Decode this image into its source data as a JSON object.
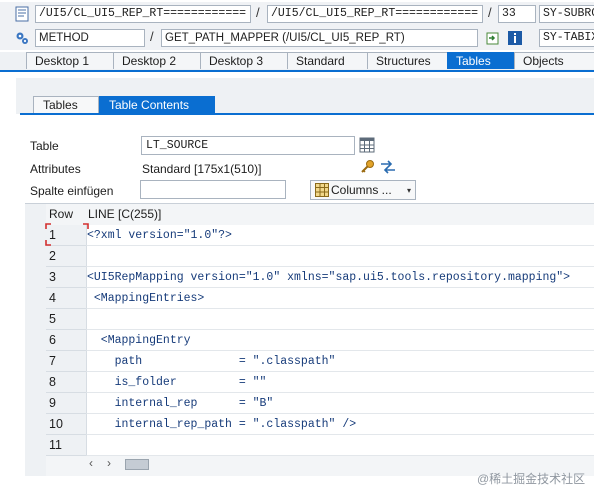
{
  "header": {
    "row1": {
      "program": "/UI5/CL_UI5_REP_RT============",
      "include": "/UI5/CL_UI5_REP_RT============",
      "line": "33",
      "sysvar": "SY-SUBRC"
    },
    "row2": {
      "event_type": "METHOD",
      "event": "GET_PATH_MAPPER (/UI5/CL_UI5_REP_RT)",
      "sysvar": "SY-TABIX"
    },
    "separator": "/"
  },
  "desktop_tabs": [
    {
      "label": "Desktop 1"
    },
    {
      "label": "Desktop 2"
    },
    {
      "label": "Desktop 3"
    },
    {
      "label": "Standard"
    },
    {
      "label": "Structures"
    },
    {
      "label": "Tables",
      "active": true
    },
    {
      "label": "Objects"
    }
  ],
  "sub_tabs": [
    {
      "label": "Tables"
    },
    {
      "label": "Table Contents",
      "active": true
    }
  ],
  "form": {
    "table_label": "Table",
    "table_value": "LT_SOURCE",
    "attributes_label": "Attributes",
    "attributes_value": "Standard [175x1(510)]",
    "insert_column_label": "Spalte einfügen",
    "insert_column_value": "",
    "columns_button": "Columns ..."
  },
  "grid": {
    "col_row": "Row",
    "col_line": "LINE [C(255)]",
    "rows": [
      {
        "row": "1",
        "line": "<?xml version=\"1.0\"?>"
      },
      {
        "row": "2",
        "line": ""
      },
      {
        "row": "3",
        "line": "<UI5RepMapping version=\"1.0\" xmlns=\"sap.ui5.tools.repository.mapping\">"
      },
      {
        "row": "4",
        "line": " <MappingEntries>"
      },
      {
        "row": "5",
        "line": ""
      },
      {
        "row": "6",
        "line": "  <MappingEntry"
      },
      {
        "row": "7",
        "line": "    path              = \".classpath\""
      },
      {
        "row": "8",
        "line": "    is_folder         = \"\""
      },
      {
        "row": "9",
        "line": "    internal_rep      = \"B\""
      },
      {
        "row": "10",
        "line": "    internal_rep_path = \".classpath\" />"
      },
      {
        "row": "11",
        "line": ""
      }
    ]
  },
  "watermark": "@稀土掘金技术社区",
  "colors": {
    "accent": "#0a6ed1",
    "code_text": "#163b7a",
    "background": "#eef1f4"
  }
}
